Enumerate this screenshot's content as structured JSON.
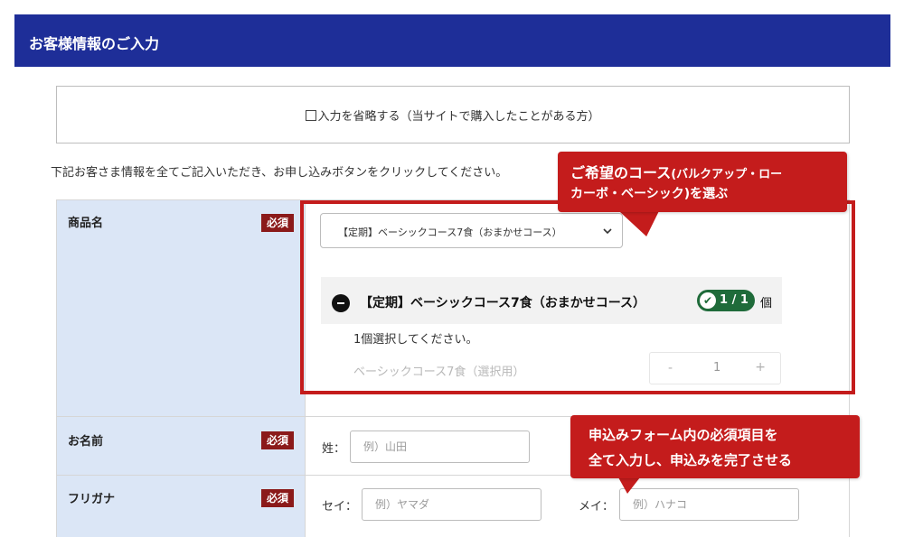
{
  "header": {
    "title": "お客様情報のご入力"
  },
  "skip": {
    "label": "入力を省略する（当サイトで購入したことがある方）"
  },
  "intro": "下記お客さま情報を全てご記入いただき、お申し込みボタンをクリックしてください。",
  "required_label": "必須",
  "product_row": {
    "label": "商品名",
    "select_value": "【定期】ベーシックコース7食（おまかせコース）",
    "product_title": "【定期】ベーシックコース7食（おまかせコース）",
    "count": "1 / 1",
    "unit": "個",
    "instruction": "1個選択してください。",
    "item_name": "ベーシックコース7食（選択用）",
    "stepper": {
      "minus": "-",
      "value": "1",
      "plus": "+"
    }
  },
  "name_row": {
    "label": "お名前",
    "sei_prefix": "姓：",
    "sei_placeholder": "例）山田"
  },
  "kana_row": {
    "label": "フリガナ",
    "sei_prefix": "セイ：",
    "sei_placeholder": "例）ヤマダ",
    "mei_prefix": "メイ：",
    "mei_placeholder": "例）ハナコ"
  },
  "callouts": {
    "course_main": "ご希望のコース",
    "course_sub": "(バルクアップ・ロー",
    "course_line2": "カーボ・ベーシック)を選ぶ",
    "form_line1": "申込みフォーム内の必須項目を",
    "form_line2": "全て入力し、申込みを完了させる"
  },
  "colors": {
    "header_bg": "#1e2e98",
    "label_bg": "#dbe6f6",
    "required_badge": "#8b1a1a",
    "annotation_red": "#c41c1c",
    "count_green": "#1f6b3a"
  }
}
